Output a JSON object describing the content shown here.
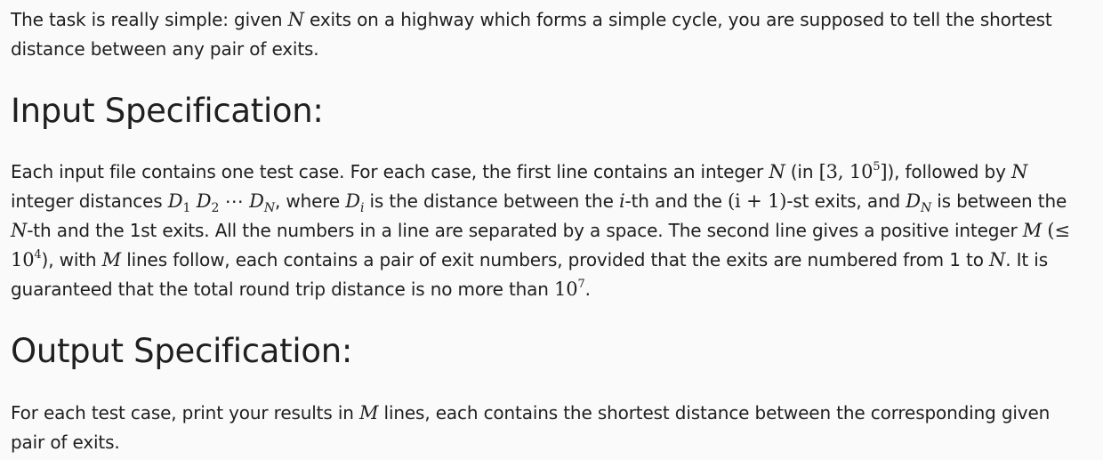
{
  "intro": {
    "t1": "The task is really simple: given ",
    "t2": " exits on a highway which forms a simple cycle, you are supposed to tell the shortest distance between any pair of exits."
  },
  "input_heading": "Input Specification:",
  "input": {
    "t1": "Each input file contains one test case. For each case, the first line contains an integer ",
    "t2": " (in ",
    "t3": "), followed by ",
    "t4": " integer distances ",
    "t5": ", where ",
    "t6": " is the distance between the ",
    "t7": "-th and the ",
    "t8": "-st exits, and ",
    "t9": " is between the ",
    "t10": "-th and the 1st exits. All the numbers in a line are separated by a space. The second line gives a positive integer ",
    "t11": "), with ",
    "t12": " lines follow, each contains a pair of exit numbers, provided that the exits are numbered from 1 to ",
    "t13": ". It is guaranteed that the total round trip distance is no more than ",
    "t14": "."
  },
  "output_heading": "Output Specification:",
  "output": {
    "t1": "For each test case, print your results in ",
    "t2": " lines, each contains the shortest distance between the corresponding given pair of exits."
  },
  "math": {
    "N": "N",
    "M": "M",
    "i": "i",
    "D": "D",
    "sub1": "1",
    "sub2": "2",
    "subi": "i",
    "dots": "⋯",
    "range_open": "[3, 10",
    "exp5": "5",
    "range_close": "]",
    "i_plus_1": "(i + 1)",
    "le": "(≤ 10",
    "exp4": "4",
    "ten": "10",
    "exp7": "7"
  }
}
